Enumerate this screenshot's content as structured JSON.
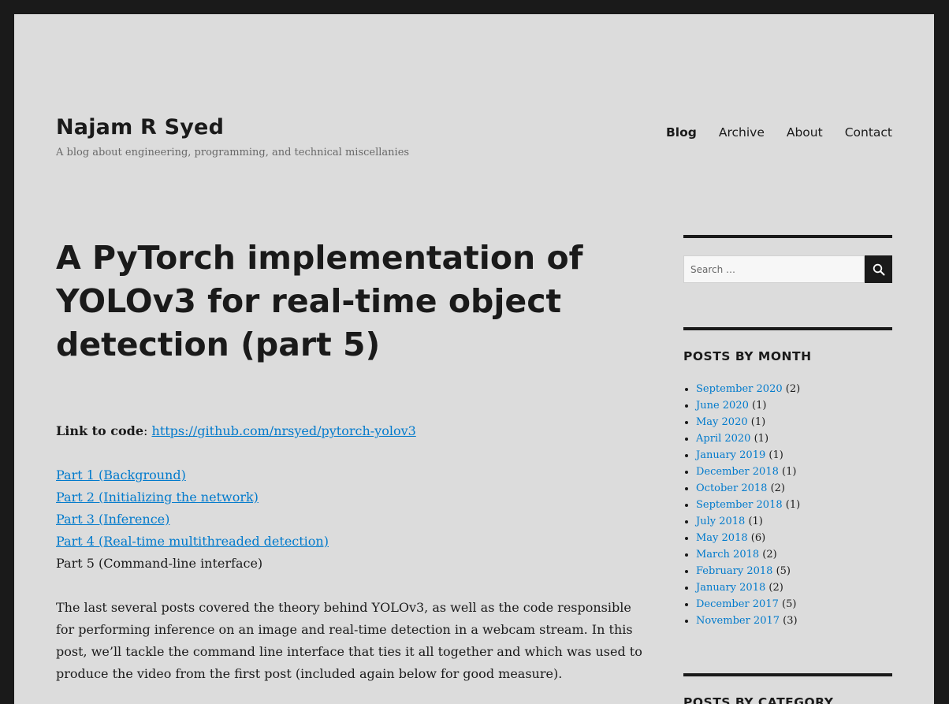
{
  "site": {
    "title": "Najam R Syed",
    "description": "A blog about engineering, programming, and technical miscellanies"
  },
  "nav": [
    {
      "label": "Blog"
    },
    {
      "label": "Archive"
    },
    {
      "label": "About"
    },
    {
      "label": "Contact"
    }
  ],
  "post": {
    "title": "A PyTorch implementation of YOLOv3 for real-time object detection (part 5)",
    "code_label": "Link to code",
    "code_url": "https://github.com/nrsyed/pytorch-yolov3",
    "parts": [
      {
        "label": "Part 1 (Background)"
      },
      {
        "label": "Part 2 (Initializing the network)"
      },
      {
        "label": "Part 3 (Inference)"
      },
      {
        "label": "Part 4 (Real-time multithreaded detection)"
      },
      {
        "label": "Part 5 (Command-line interface)"
      }
    ],
    "intro": "The last several posts covered the theory behind YOLOv3, as well as the code responsible for performing inference on an image and real-time detection in a webcam stream. In this post, we’ll tackle the command line interface that ties it all together and which was used to produce the video from the first post (included again below for good measure)."
  },
  "sidebar": {
    "search_placeholder": "Search …",
    "posts_by_month_title": "POSTS BY MONTH",
    "months": [
      {
        "label": "September 2020",
        "count": "(2)"
      },
      {
        "label": "June 2020",
        "count": "(1)"
      },
      {
        "label": "May 2020",
        "count": "(1)"
      },
      {
        "label": "April 2020",
        "count": "(1)"
      },
      {
        "label": "January 2019",
        "count": "(1)"
      },
      {
        "label": "December 2018",
        "count": "(1)"
      },
      {
        "label": "October 2018",
        "count": "(2)"
      },
      {
        "label": "September 2018",
        "count": "(1)"
      },
      {
        "label": "July 2018",
        "count": "(1)"
      },
      {
        "label": "May 2018",
        "count": "(6)"
      },
      {
        "label": "March 2018",
        "count": "(2)"
      },
      {
        "label": "February 2018",
        "count": "(5)"
      },
      {
        "label": "January 2018",
        "count": "(2)"
      },
      {
        "label": "December 2017",
        "count": "(5)"
      },
      {
        "label": "November 2017",
        "count": "(3)"
      }
    ],
    "posts_by_category_title": "POSTS BY CATEGORY"
  },
  "colors": {
    "background": "#dcdcdc",
    "frame": "#1a1a1a",
    "link": "#007acc",
    "text": "#1a1a1a"
  },
  "icons": {
    "search_button": "search-icon"
  }
}
